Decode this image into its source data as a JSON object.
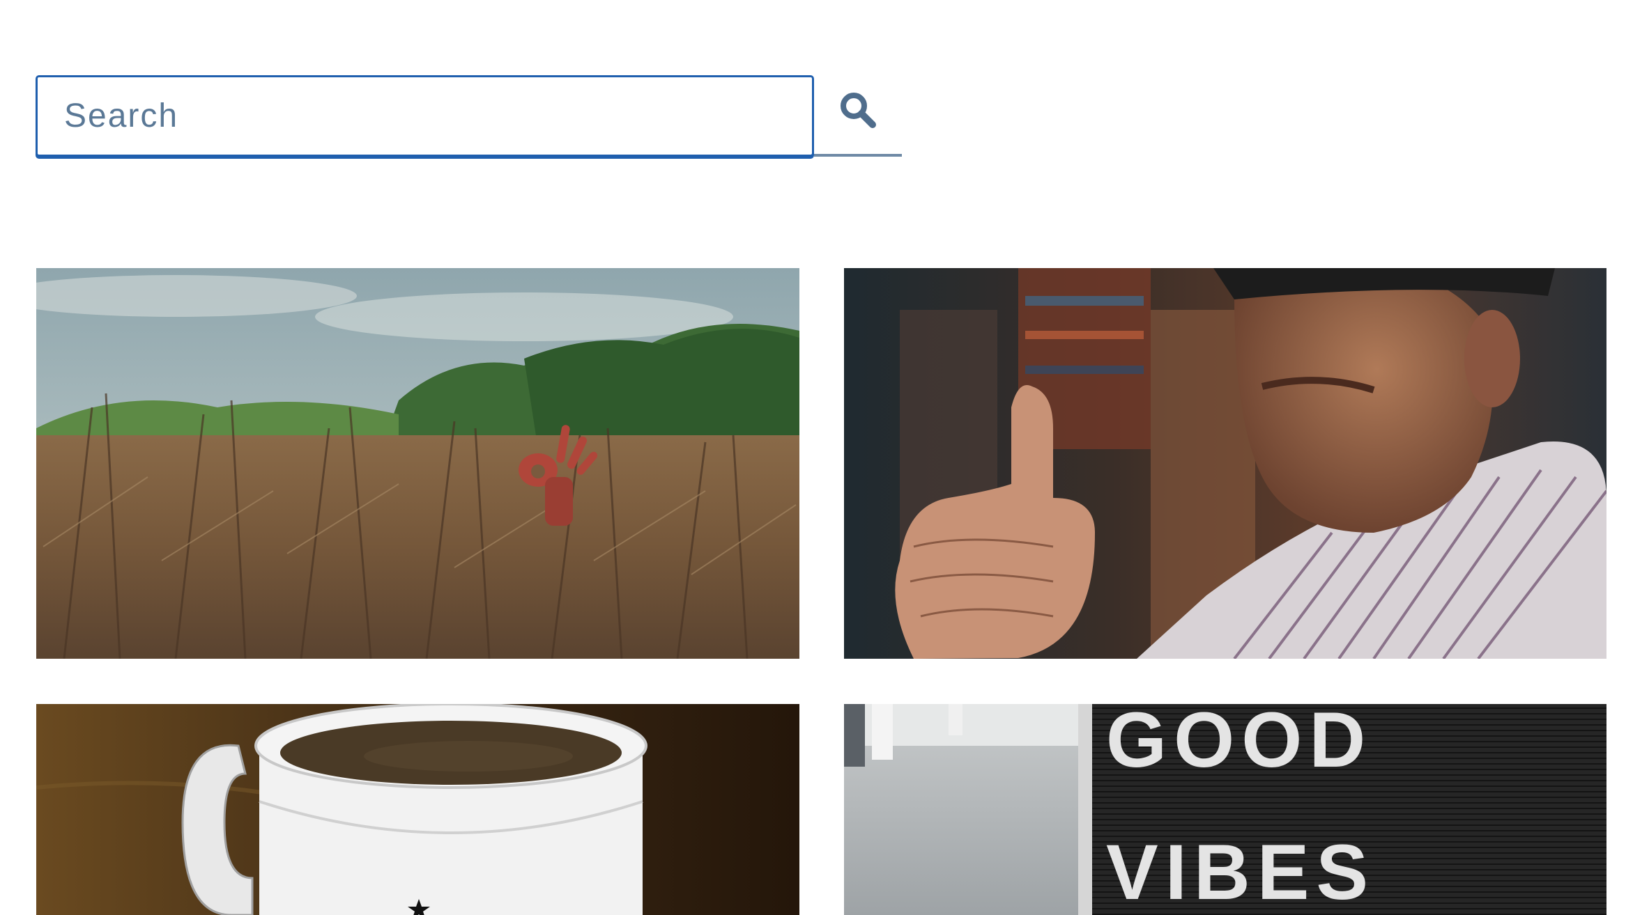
{
  "search": {
    "placeholder": "Search",
    "value": "",
    "button_icon": "search-icon"
  },
  "gallery": {
    "photos": [
      {
        "subject": "hand-ok-sign-in-field"
      },
      {
        "subject": "old-man-thumbs-up"
      },
      {
        "subject": "coffee-mug"
      },
      {
        "subject": "letter-board-sign",
        "sign_line_1": "GOOD",
        "sign_line_2": "VIBES"
      }
    ]
  },
  "colors": {
    "accent": "#1f5fae",
    "icon": "#4f6d8c",
    "placeholder": "#5a7896"
  }
}
